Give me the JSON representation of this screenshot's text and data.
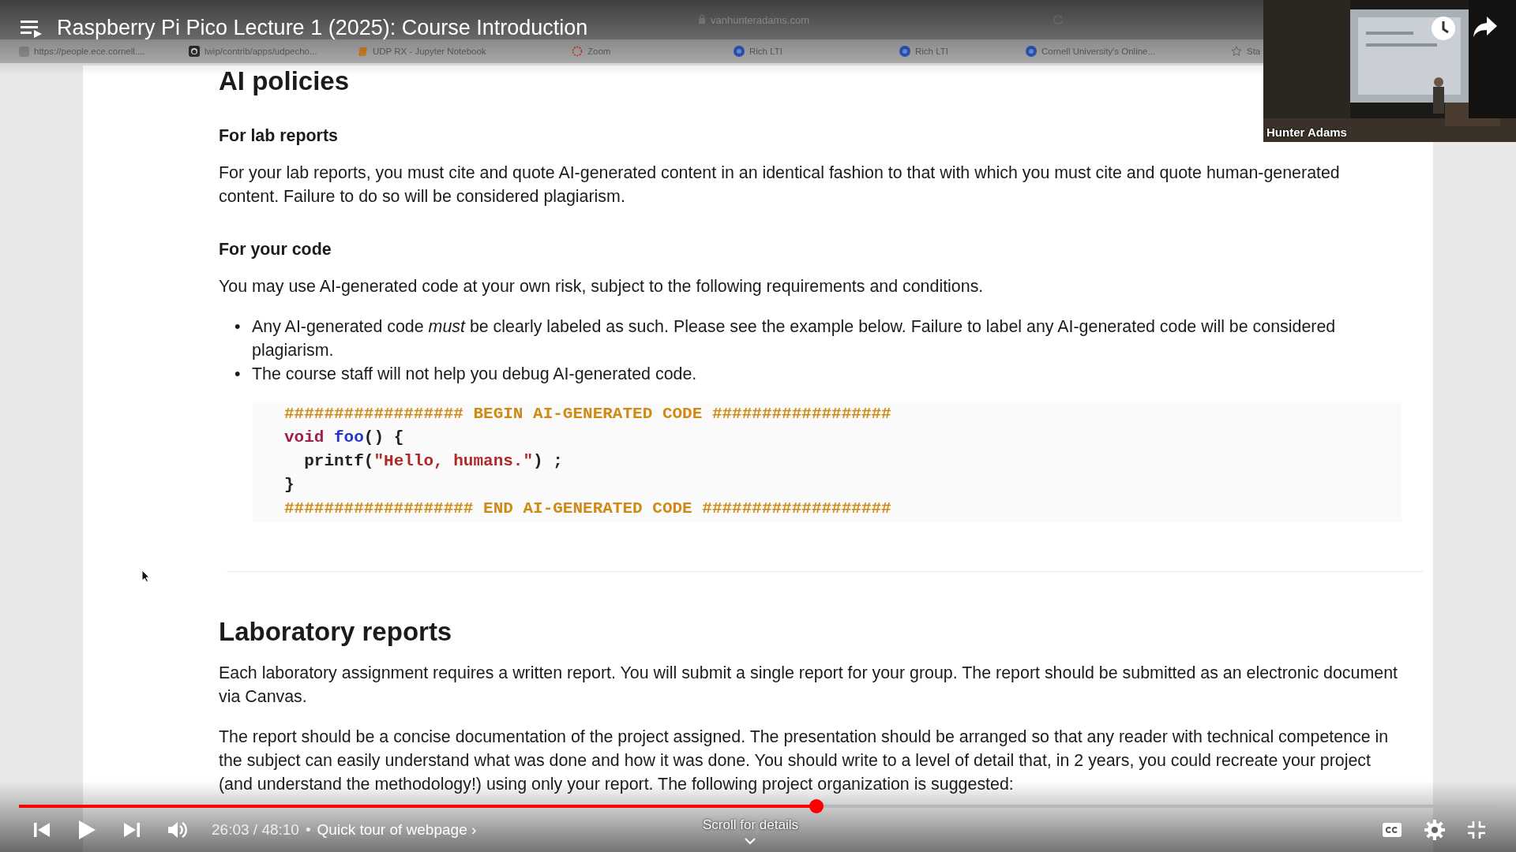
{
  "video": {
    "title": "Raspberry Pi Pico Lecture 1 (2025): Course Introduction",
    "time": "26:03 / 48:10",
    "separator": "•",
    "chapter": "Quick tour of webpage ›",
    "hint": "Scroll for details",
    "progress": {
      "level": 0.54
    }
  },
  "browser": {
    "address": "vanhunteradams.com",
    "bookmarks": [
      {
        "label": "https://people.ece.cornell....",
        "kind": "site"
      },
      {
        "label": "lwip/contrib/apps/udpecho...",
        "kind": "github"
      },
      {
        "label": "UDP RX - Jupyter Notebook",
        "kind": "notebook"
      },
      {
        "label": "Zoom",
        "kind": "zoom"
      },
      {
        "label": "Rich LTI",
        "kind": "lti"
      },
      {
        "label": "Rich LTI",
        "kind": "lti"
      },
      {
        "label": "Cornell University's Online...",
        "kind": "lti"
      },
      {
        "label": "Sta",
        "kind": "star"
      }
    ]
  },
  "camera": {
    "name": "Hunter Adams"
  },
  "document": {
    "blocks": [
      {
        "kind": "h1",
        "text": "AI policies"
      },
      {
        "kind": "h2",
        "text": "For lab reports"
      },
      {
        "kind": "p",
        "text": "For your lab reports, you must cite and quote AI-generated content in an identical fashion to that with which you must cite and quote human-generated content. Failure to do so will be considered plagiarism."
      },
      {
        "kind": "h2",
        "text": "For your code"
      },
      {
        "kind": "p",
        "text": "You may use AI-generated code at your own risk, subject to the following requirements and conditions."
      },
      {
        "kind": "list",
        "items": [
          {
            "marker": "•",
            "text": "Any AI-generated code *must* be clearly labeled as such. Please see the example below. Failure to label any AI-generated code will be considered plagiarism."
          },
          {
            "marker": "•",
            "text": "The course staff will not help you debug AI-generated code."
          }
        ]
      },
      {
        "kind": "code",
        "lines": [
          [
            {
              "kind": "comment",
              "text": "################## BEGIN AI-GENERATED CODE ##################"
            }
          ],
          [
            {
              "kind": "keyword",
              "text": "void "
            },
            {
              "kind": "function",
              "text": "foo"
            },
            {
              "kind": "plain",
              "text": "() {"
            }
          ],
          [
            {
              "kind": "plain",
              "text": "  printf("
            },
            {
              "kind": "string",
              "text": "\"Hello, humans.\""
            },
            {
              "kind": "plain",
              "text": ") ;"
            }
          ],
          [
            {
              "kind": "plain",
              "text": "}"
            }
          ],
          [
            {
              "kind": "comment",
              "text": "################### END AI-GENERATED CODE ###################"
            }
          ]
        ]
      },
      {
        "kind": "divider"
      },
      {
        "kind": "h1",
        "text": "Laboratory reports"
      },
      {
        "kind": "p",
        "text": "Each laboratory assignment requires a written report. You will submit a single report for your group. The report should be submitted as an electronic document via Canvas."
      },
      {
        "kind": "p",
        "text": "The report should be a concise documentation of the project assigned. The presentation should be arranged so that any reader with technical competence in the subject can easily understand what was done and how it was done. You should write to a level of detail that, in 2 years, you could recreate your project (and understand the methodology!) using only your report. The following project organization is suggested:"
      }
    ]
  }
}
